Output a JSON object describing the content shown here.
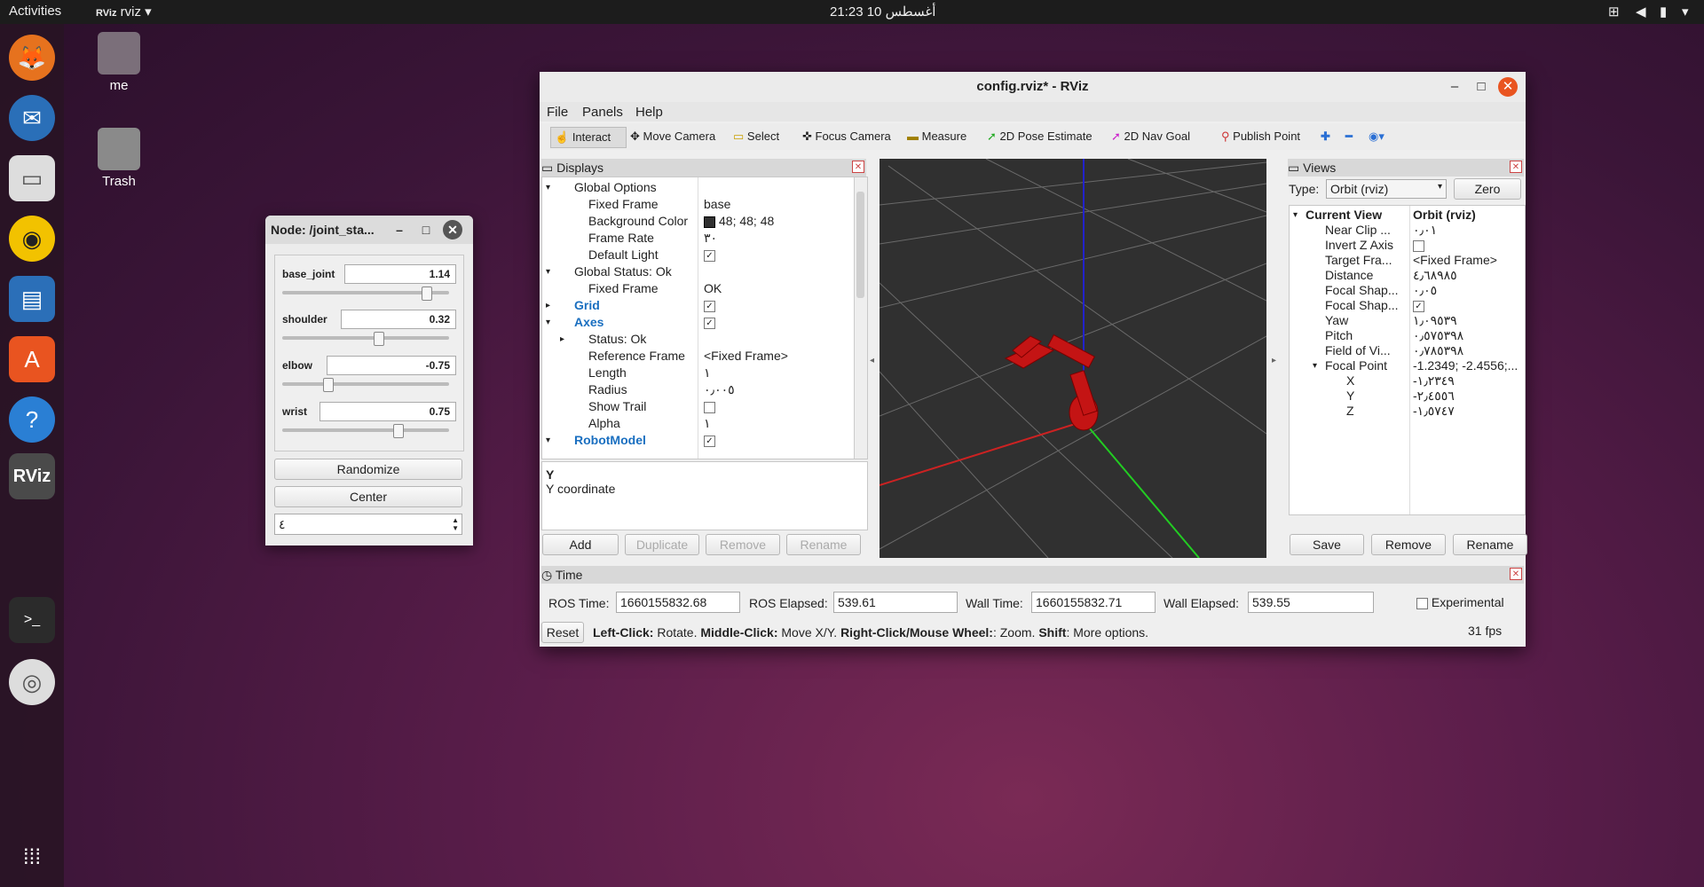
{
  "topbar": {
    "activities": "Activities",
    "app": "rviz",
    "datetime": "21:23 10 أغسطس"
  },
  "desktop": {
    "home_label": "me",
    "trash_label": "Trash"
  },
  "joint_state": {
    "title": "Node: /joint_sta...",
    "joints": [
      {
        "name": "base_joint",
        "value": "1.14",
        "position": 0.88
      },
      {
        "name": "shoulder",
        "value": "0.32",
        "position": 0.58
      },
      {
        "name": "elbow",
        "value": "-0.75",
        "position": 0.26
      },
      {
        "name": "wrist",
        "value": "0.75",
        "position": 0.7
      }
    ],
    "randomize": "Randomize",
    "center": "Center",
    "spin_value": "٤"
  },
  "rviz": {
    "title": "config.rviz* - RViz",
    "menu": {
      "file": "File",
      "panels": "Panels",
      "help": "Help"
    },
    "tools": [
      "Interact",
      "Move Camera",
      "Select",
      "Focus Camera",
      "Measure",
      "2D Pose Estimate",
      "2D Nav Goal",
      "Publish Point"
    ],
    "displays": {
      "header": "Displays",
      "rows": [
        {
          "name": "Global Options",
          "value": "",
          "indent": 1,
          "expand": "▾"
        },
        {
          "name": "Fixed Frame",
          "value": "base",
          "indent": 2
        },
        {
          "name": "Background Color",
          "value": "48; 48; 48",
          "indent": 2
        },
        {
          "name": "Frame Rate",
          "value": "٣٠",
          "indent": 2
        },
        {
          "name": "Default Light",
          "value": "✓",
          "indent": 2
        },
        {
          "name": "Global Status: Ok",
          "value": "",
          "indent": 1,
          "expand": "▾"
        },
        {
          "name": "Fixed Frame",
          "value": "OK",
          "indent": 2
        },
        {
          "name": "Grid",
          "value": "✓",
          "indent": 1,
          "expand": "▸"
        },
        {
          "name": "Axes",
          "value": "✓",
          "indent": 1,
          "expand": "▾"
        },
        {
          "name": "Status: Ok",
          "value": "",
          "indent": 2,
          "expand": "▸"
        },
        {
          "name": "Reference Frame",
          "value": "<Fixed Frame>",
          "indent": 2
        },
        {
          "name": "Length",
          "value": "١",
          "indent": 2
        },
        {
          "name": "Radius",
          "value": "٠٫٠٠٥",
          "indent": 2
        },
        {
          "name": "Show Trail",
          "value": "",
          "indent": 2
        },
        {
          "name": "Alpha",
          "value": "١",
          "indent": 2
        },
        {
          "name": "RobotModel",
          "value": "✓",
          "indent": 1,
          "expand": "▾"
        }
      ],
      "desc_title": "Y",
      "desc_text": "Y coordinate",
      "buttons": {
        "add": "Add",
        "duplicate": "Duplicate",
        "remove": "Remove",
        "rename": "Rename"
      }
    },
    "views": {
      "header": "Views",
      "type_label": "Type:",
      "type_value": "Orbit (rviz)",
      "zero": "Zero",
      "rows": [
        {
          "name": "Current View",
          "value": "Orbit (rviz)"
        },
        {
          "name": "Near Clip ...",
          "value": "٠٫٠١"
        },
        {
          "name": "Invert Z Axis",
          "value": ""
        },
        {
          "name": "Target Fra...",
          "value": "<Fixed Frame>"
        },
        {
          "name": "Distance",
          "value": "٤٫٦٨٩٨٥"
        },
        {
          "name": "Focal Shap...",
          "value": "٠٫٠٥"
        },
        {
          "name": "Focal Shap...",
          "value": "✓"
        },
        {
          "name": "Yaw",
          "value": "١٫٠٩٥٣٩"
        },
        {
          "name": "Pitch",
          "value": "٠٫٥٧٥٣٩٨"
        },
        {
          "name": "Field of Vi...",
          "value": "٠٫٧٨٥٣٩٨"
        },
        {
          "name": "Focal Point",
          "value": "-1.2349; -2.4556;..."
        },
        {
          "name": "X",
          "value": "-١٫٢٣٤٩"
        },
        {
          "name": "Y",
          "value": "-٢٫٤٥٥٦"
        },
        {
          "name": "Z",
          "value": "-١٫٥٧٤٧"
        }
      ],
      "buttons": {
        "save": "Save",
        "remove": "Remove",
        "rename": "Rename"
      }
    },
    "time": {
      "header": "Time",
      "ros_time_label": "ROS Time:",
      "ros_time": "1660155832.68",
      "ros_elapsed_label": "ROS Elapsed:",
      "ros_elapsed": "539.61",
      "wall_time_label": "Wall Time:",
      "wall_time": "1660155832.71",
      "wall_elapsed_label": "Wall Elapsed:",
      "wall_elapsed": "539.55",
      "experimental": "Experimental",
      "reset": "Reset",
      "status_parts": [
        {
          "text": "Left-Click:",
          "bold": true
        },
        {
          "text": " Rotate. ",
          "bold": false
        },
        {
          "text": "Middle-Click:",
          "bold": true
        },
        {
          "text": " Move X/Y. ",
          "bold": false
        },
        {
          "text": "Right-Click/Mouse Wheel:",
          "bold": true
        },
        {
          "text": ": Zoom. ",
          "bold": false
        },
        {
          "text": "Shift",
          "bold": true
        },
        {
          "text": ": More options.",
          "bold": false
        }
      ],
      "fps": "31 fps"
    }
  }
}
